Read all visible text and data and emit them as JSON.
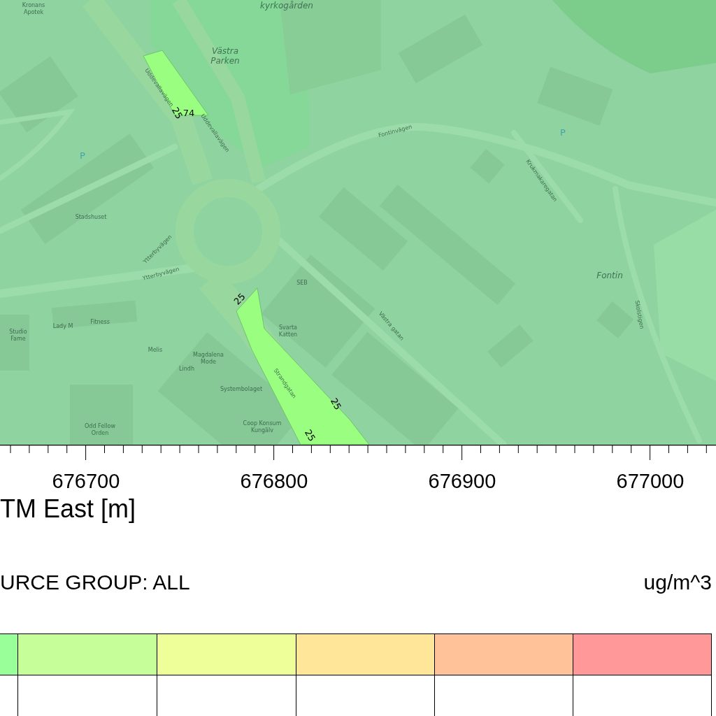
{
  "map": {
    "labels": [
      {
        "kind": "poi",
        "lines": [
          "Kronans",
          "Apotek"
        ]
      },
      {
        "kind": "place",
        "lines": [
          "kyrkogården"
        ]
      },
      {
        "kind": "place",
        "lines": [
          "Västra",
          "Parken"
        ]
      },
      {
        "kind": "street",
        "lines": [
          "Uddevallavägen"
        ]
      },
      {
        "kind": "street",
        "lines": [
          "Uddevallavägen"
        ]
      },
      {
        "kind": "contour",
        "lines": [
          "74"
        ]
      },
      {
        "kind": "contour",
        "lines": [
          "25"
        ]
      },
      {
        "kind": "parking",
        "lines": [
          "P"
        ]
      },
      {
        "kind": "street",
        "lines": [
          "Fontinvägen"
        ]
      },
      {
        "kind": "parking",
        "lines": [
          "P"
        ]
      },
      {
        "kind": "street",
        "lines": [
          "Krukmakaregatan"
        ]
      },
      {
        "kind": "poi",
        "lines": [
          "Stadshuset"
        ]
      },
      {
        "kind": "street",
        "lines": [
          "Ytterbyvägen"
        ]
      },
      {
        "kind": "street",
        "lines": [
          "Ytterbyvägen"
        ]
      },
      {
        "kind": "place",
        "lines": [
          "Fontin"
        ]
      },
      {
        "kind": "poi",
        "lines": [
          "SEB"
        ]
      },
      {
        "kind": "contour",
        "lines": [
          "25"
        ]
      },
      {
        "kind": "street",
        "lines": [
          "Västra gatan"
        ]
      },
      {
        "kind": "street",
        "lines": [
          "Skolstigen"
        ]
      },
      {
        "kind": "poi",
        "lines": [
          "Svarta",
          "Katten"
        ]
      },
      {
        "kind": "poi",
        "lines": [
          "Studio",
          "Fame"
        ]
      },
      {
        "kind": "poi",
        "lines": [
          "Lady M"
        ]
      },
      {
        "kind": "poi",
        "lines": [
          "Fitness"
        ]
      },
      {
        "kind": "poi",
        "lines": [
          "Melis"
        ]
      },
      {
        "kind": "poi",
        "lines": [
          "Lindh"
        ]
      },
      {
        "kind": "poi",
        "lines": [
          "Magdalena",
          "Mode"
        ]
      },
      {
        "kind": "poi",
        "lines": [
          "Systembolaget"
        ]
      },
      {
        "kind": "street",
        "lines": [
          "Strandgatan"
        ]
      },
      {
        "kind": "contour",
        "lines": [
          "25"
        ]
      },
      {
        "kind": "poi",
        "lines": [
          "Odd Fellow",
          "Orden"
        ]
      },
      {
        "kind": "poi",
        "lines": [
          "Coop Konsum",
          "Kungälv"
        ]
      },
      {
        "kind": "contour",
        "lines": [
          "25"
        ]
      }
    ]
  },
  "x_axis": {
    "tick_labels": [
      "676700",
      "676800",
      "676900",
      "677000"
    ],
    "title": "TM East [m]"
  },
  "source_group": "URCE GROUP: ALL",
  "units": "ug/m^3",
  "legend": [
    {
      "color": "#99ff99"
    },
    {
      "color": "#c6ff99"
    },
    {
      "color": "#eeff99"
    },
    {
      "color": "#ffe699"
    },
    {
      "color": "#ffc299"
    },
    {
      "color": "#ff9999"
    }
  ]
}
